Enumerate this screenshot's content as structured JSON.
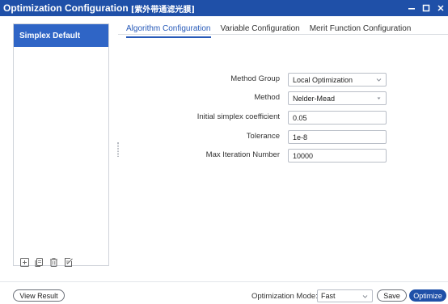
{
  "window": {
    "title": "Optimization Configuration",
    "subtitle": "[紫外带通滤光膜]",
    "controls": {
      "minimize": "—",
      "maximize": "☐",
      "close": "×"
    }
  },
  "sidebar": {
    "items": [
      {
        "label": "Simplex Default",
        "selected": true
      }
    ],
    "toolbar_icons": [
      "add-icon",
      "copy-icon",
      "delete-icon",
      "edit-icon"
    ]
  },
  "tabs": [
    {
      "label": "Algorithm Configuration",
      "active": true
    },
    {
      "label": "Variable Configuration",
      "active": false
    },
    {
      "label": "Merit Function Configuration",
      "active": false
    }
  ],
  "form": {
    "method_group": {
      "label": "Method Group",
      "value": "Local Optimization"
    },
    "method": {
      "label": "Method",
      "value": "Nelder-Mead"
    },
    "simplex_coef": {
      "label": "Initial simplex coefficient",
      "value": "0.05"
    },
    "tolerance": {
      "label": "Tolerance",
      "value": "1e-8"
    },
    "max_iter": {
      "label": "Max Iteration Number",
      "value": "10000"
    }
  },
  "footer": {
    "view_result": "View Result",
    "mode_label": "Optimization Mode:",
    "mode_value": "Fast",
    "save": "Save",
    "optimize": "Optimize"
  },
  "colors": {
    "accent": "#1f50a8",
    "selected": "#2f65c6",
    "tab_active": "#2659b8"
  }
}
